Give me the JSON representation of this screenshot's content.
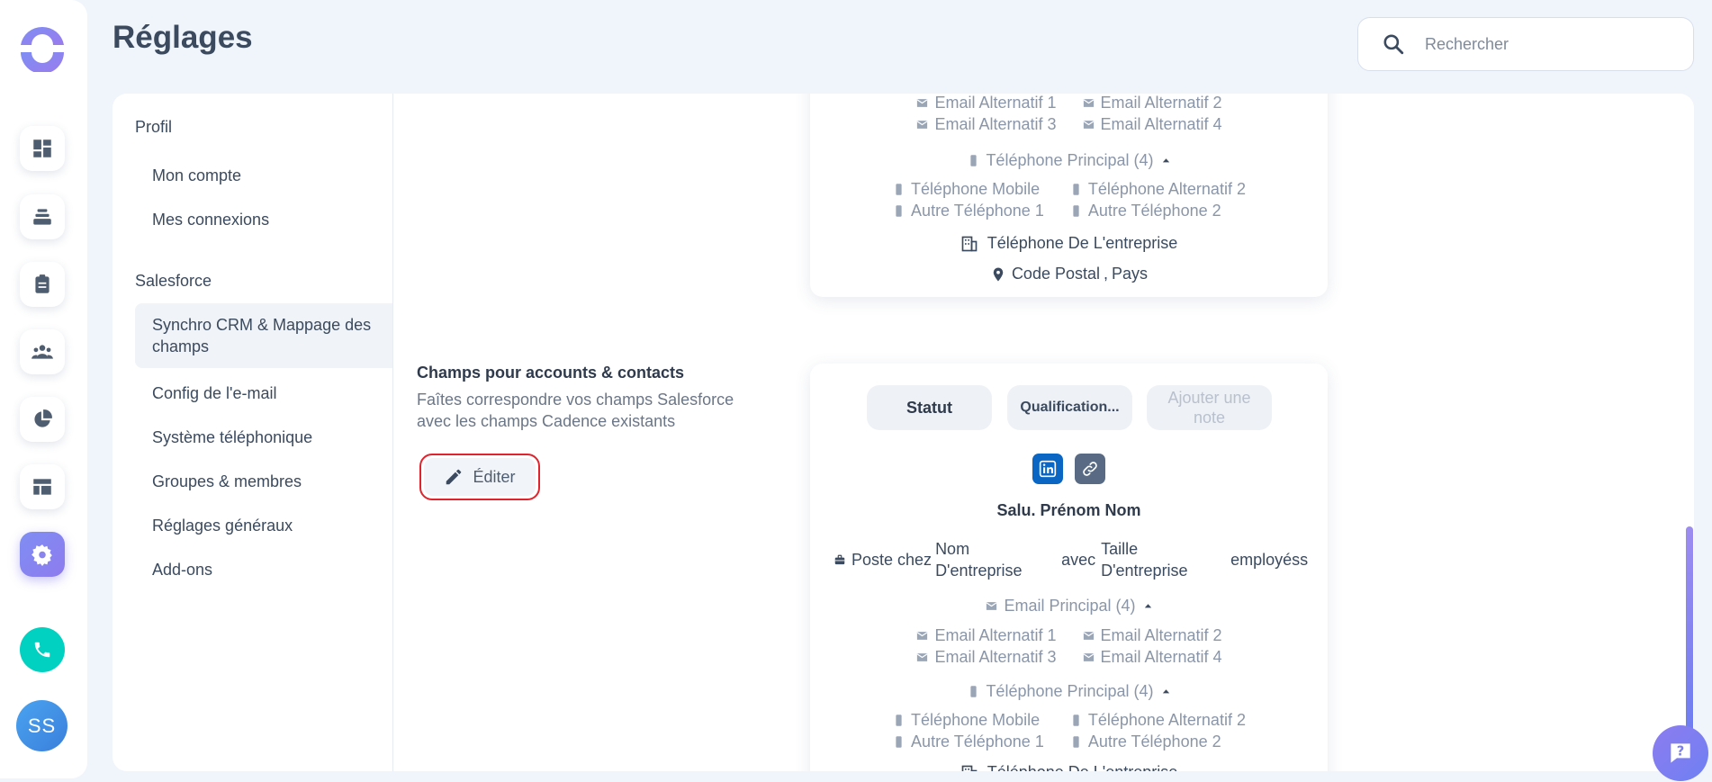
{
  "page": {
    "title": "Réglages"
  },
  "search": {
    "placeholder": "Rechercher"
  },
  "user": {
    "initials": "SS"
  },
  "menu": {
    "profil_header": "Profil",
    "mon_compte": "Mon compte",
    "mes_connexions": "Mes connexions",
    "salesforce_header": "Salesforce",
    "synchro": "Synchro CRM & Mappage des champs",
    "config_email": "Config de l'e-mail",
    "systeme_tel": "Système téléphonique",
    "groupes": "Groupes & membres",
    "reglages_generaux": "Réglages généraux",
    "addons": "Add-ons"
  },
  "section": {
    "title": "Champs pour accounts & contacts",
    "description": "Faîtes correspondre vos champs Salesforce avec les champs Cadence existants",
    "edit_label": "Éditer"
  },
  "preview": {
    "status": "Statut",
    "qualification": "Qualification...",
    "add_note": "Ajouter une note",
    "name": "Salu. Prénom Nom",
    "poste_chez": "Poste chez",
    "nom_entreprise": "Nom D'entreprise",
    "avec": "avec",
    "taille_entreprise": "Taille D'entreprise",
    "employes": "employéss",
    "email_principal": "Email Principal (4)",
    "email_alt_1": "Email Alternatif 1",
    "email_alt_2": "Email Alternatif 2",
    "email_alt_3": "Email Alternatif 3",
    "email_alt_4": "Email Alternatif 4",
    "tel_principal": "Téléphone Principal (4)",
    "tel_mobile": "Téléphone Mobile",
    "tel_alt_2": "Téléphone Alternatif 2",
    "autre_tel_1": "Autre Téléphone 1",
    "autre_tel_2": "Autre Téléphone 2",
    "tel_entreprise": "Téléphone De L'entreprise",
    "code_postal": "Code Postal",
    "pays": "Pays",
    "separator": ","
  },
  "colors": {
    "accent": "#8e7bee",
    "phone": "#00d1c1",
    "linkedin": "#0a66c2",
    "highlight": "#e0242e"
  }
}
